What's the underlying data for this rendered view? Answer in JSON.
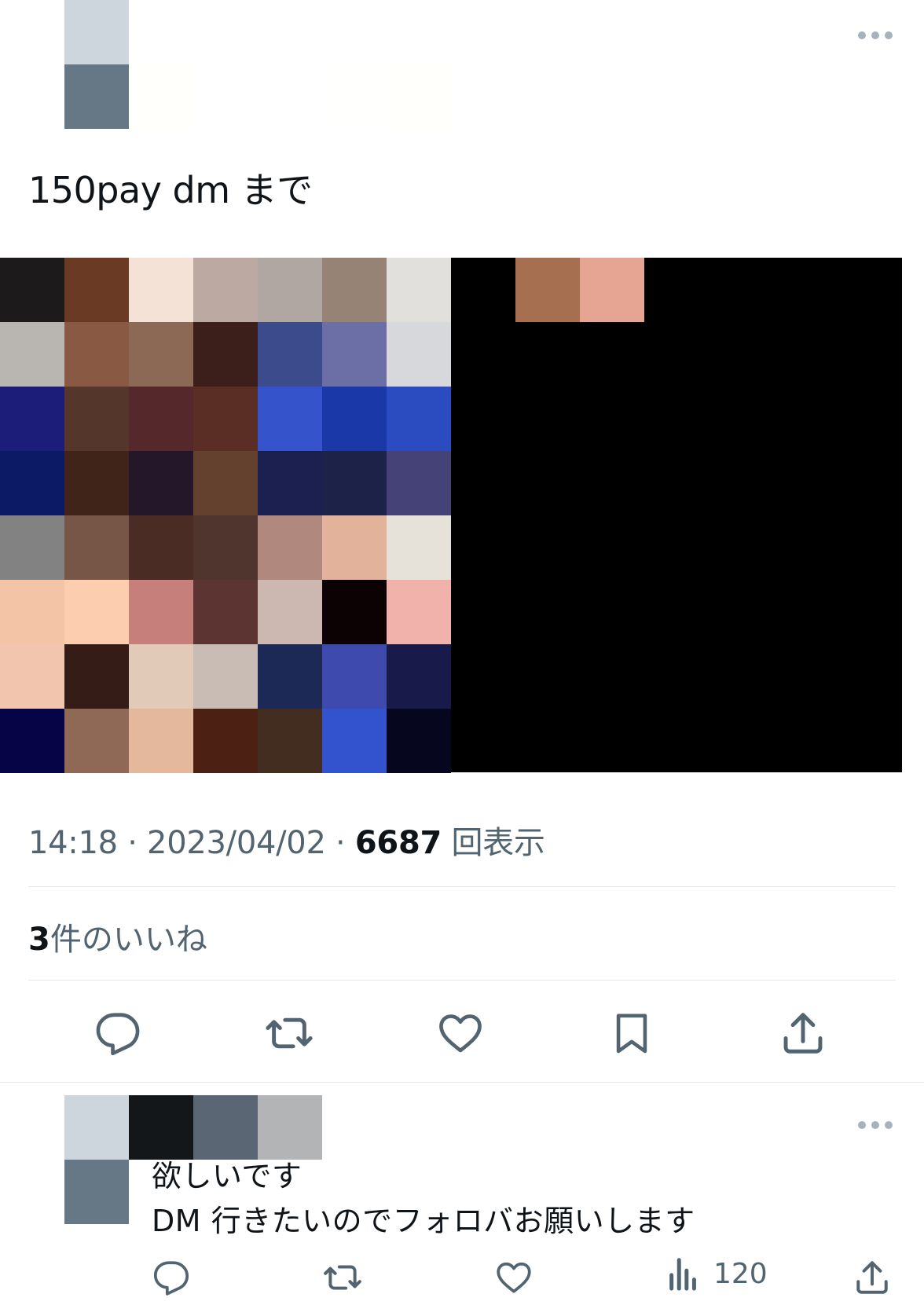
{
  "post": {
    "text": "150pay dm まで",
    "time": "14:18",
    "date": "2023/04/02",
    "views_count": "6687",
    "views_label": "回表示",
    "likes_count": "3",
    "likes_label": "件のいいね"
  },
  "reply": {
    "line1": "欲しいです",
    "line2": "DM 行きたいのでフォロバお願いします",
    "views_count": "120"
  },
  "icons": {
    "more": "more-icon",
    "reply": "reply-icon",
    "repost": "repost-icon",
    "like": "heart-icon",
    "bookmark": "bookmark-icon",
    "share": "share-icon",
    "analytics": "analytics-icon"
  },
  "colors": {
    "text_primary": "#0f1419",
    "text_secondary": "#536471",
    "icon": "#536471",
    "divider": "#e5e9ec"
  }
}
